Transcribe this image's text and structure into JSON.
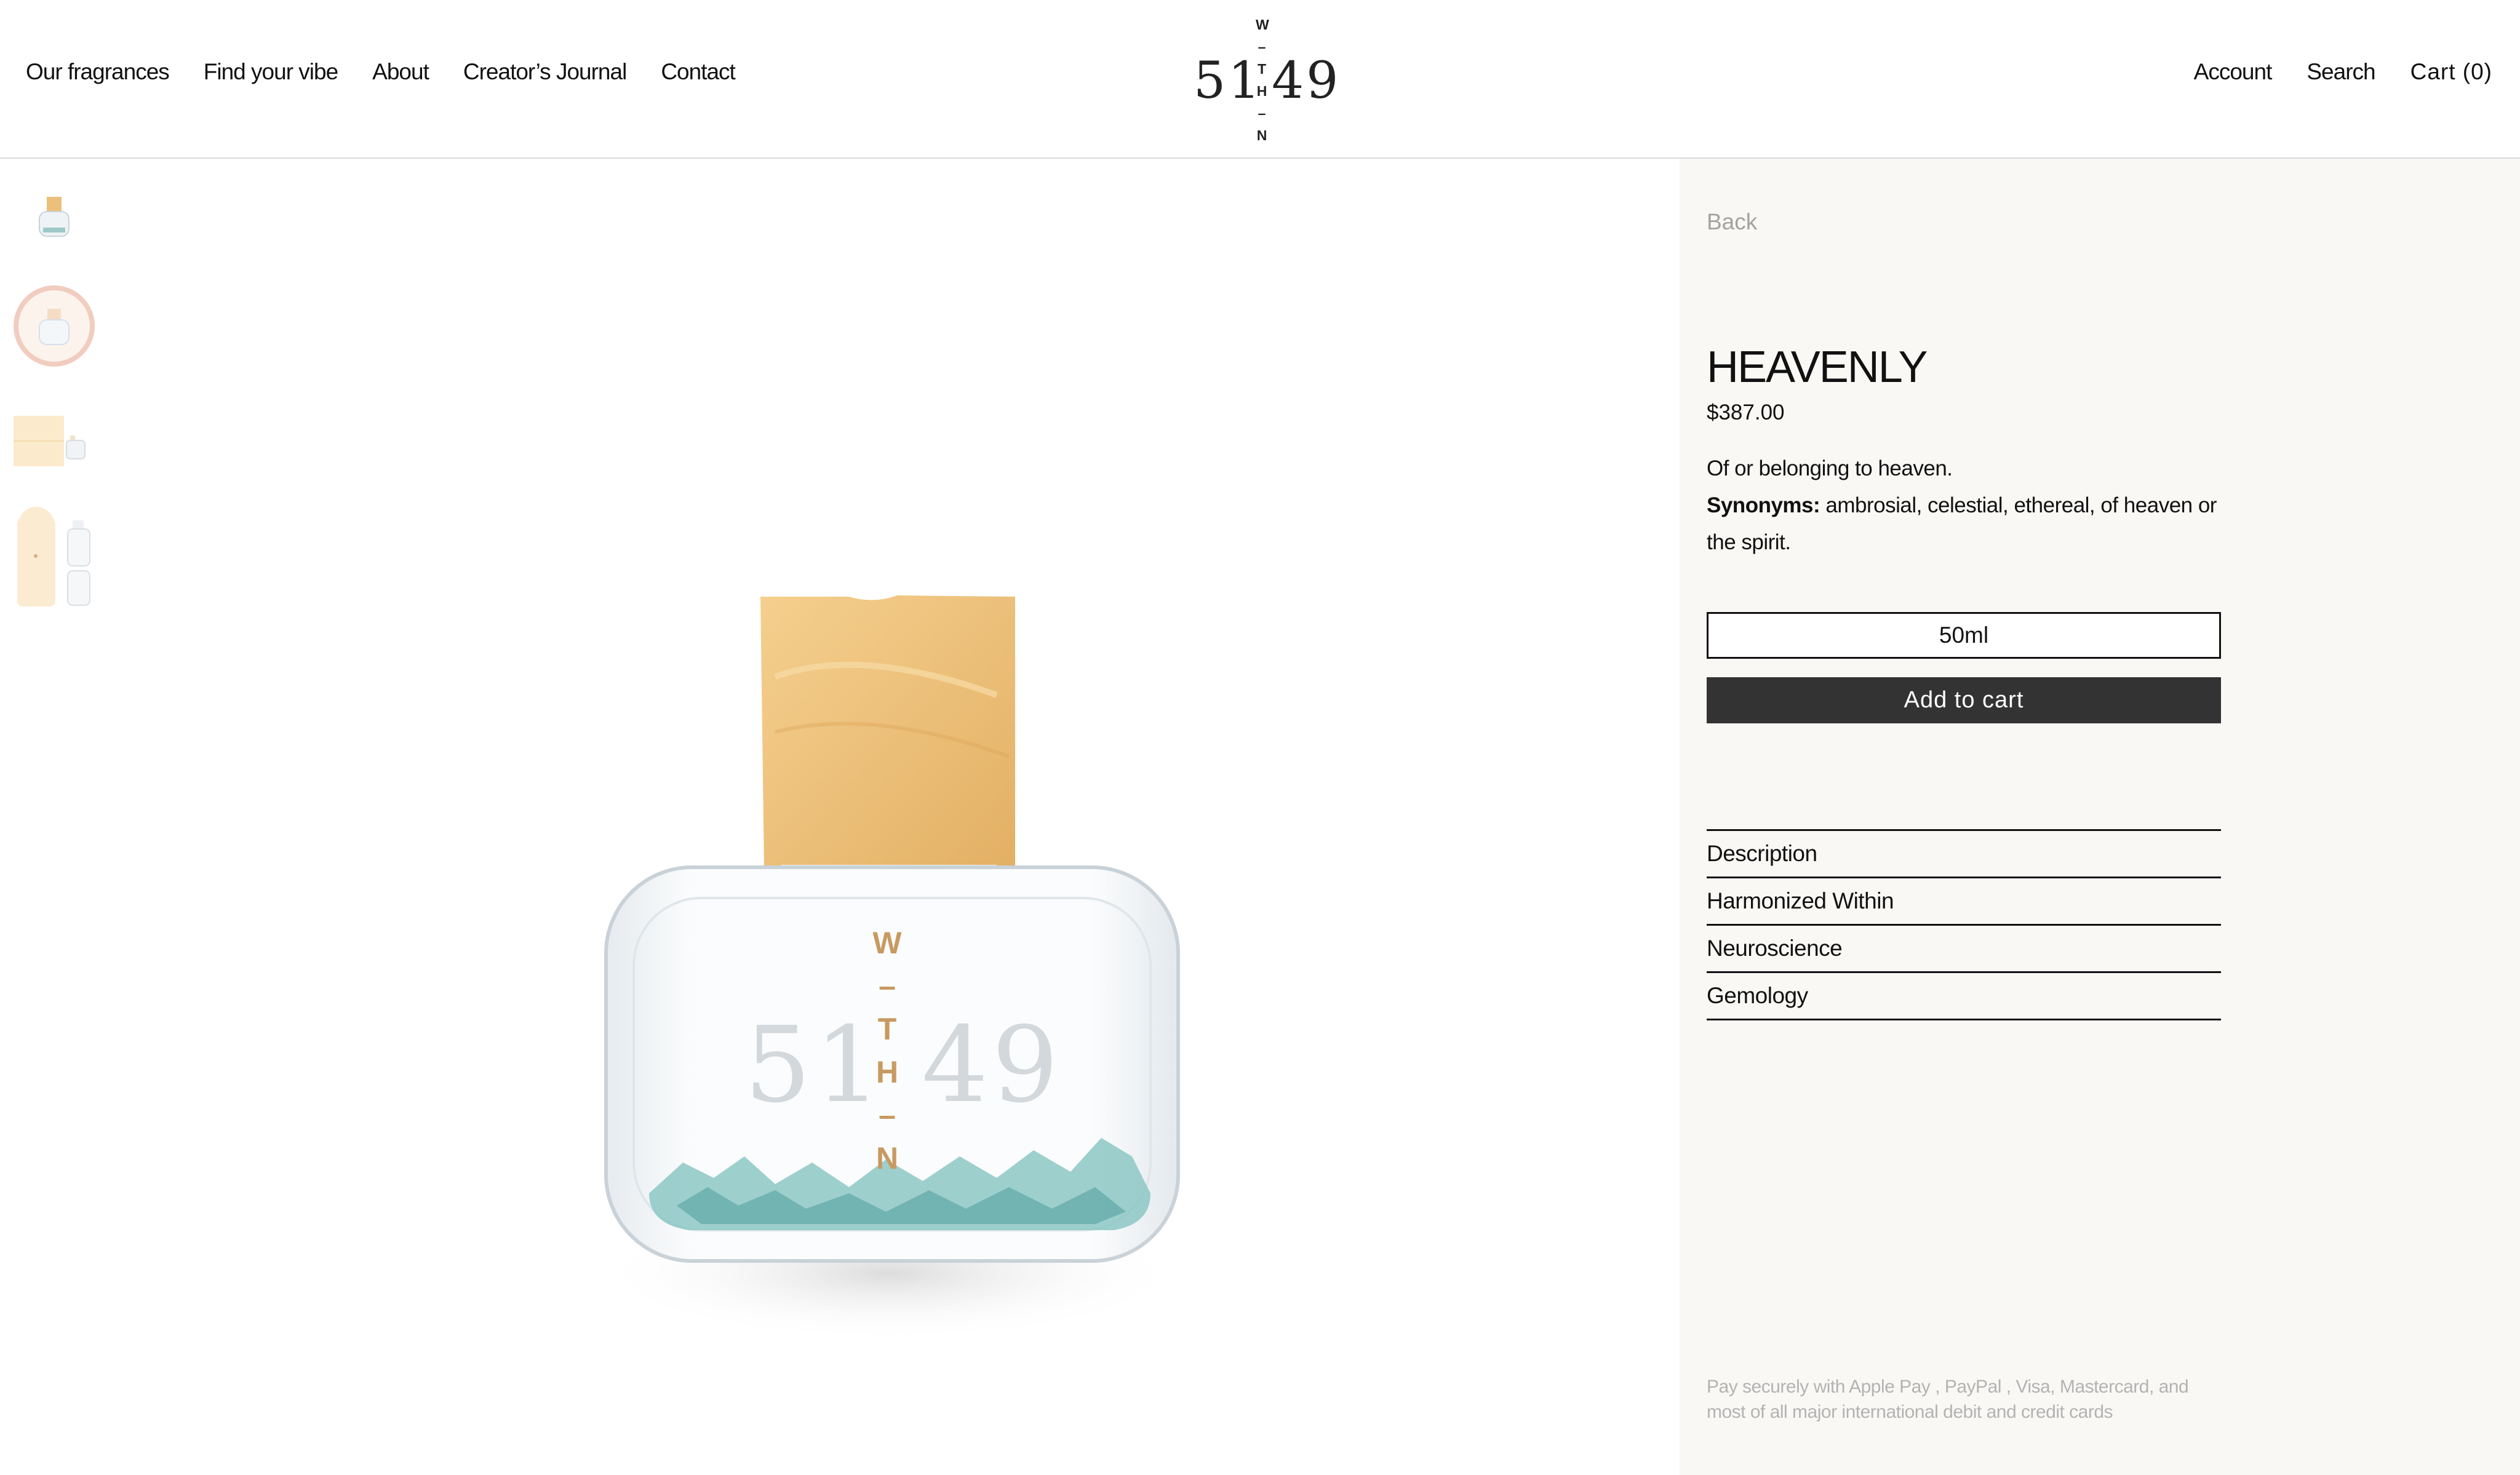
{
  "header": {
    "nav_left": [
      "Our fragrances",
      "Find your vibe",
      "About",
      "Creator’s Journal",
      "Contact"
    ],
    "logo": {
      "left_number": "51",
      "right_number": "49",
      "vertical_letters": [
        "W",
        "–",
        "T",
        "H",
        "–",
        "N"
      ]
    },
    "nav_right": {
      "account": "Account",
      "search": "Search",
      "cart": "Cart (0)"
    }
  },
  "gallery": {
    "thumbnails": [
      "bottle-front",
      "bottle-halo",
      "gift-box",
      "bottle-pouch"
    ],
    "main_image": {
      "logo_left": "51",
      "logo_right": "49",
      "vertical_letters": [
        "W",
        "–",
        "T",
        "H",
        "–",
        "N"
      ]
    }
  },
  "product": {
    "back_label": "Back",
    "title": "HEAVENLY",
    "price": "$387.00",
    "description_line1": "Of or belonging to heaven.",
    "synonyms_label": "Synonyms:",
    "synonyms_text": " ambrosial, celestial, ethereal, of heaven or the spirit.",
    "variant": "50ml",
    "add_to_cart": "Add to cart",
    "accordion": [
      "Description",
      "Harmonized Within",
      "Neuroscience",
      "Gemology"
    ],
    "payment_note": "Pay securely with Apple Pay , PayPal , Visa, Mastercard, and most of all major international debit and credit cards"
  },
  "colors": {
    "panel_bg": "#f9f8f5",
    "button_dark": "#333333",
    "cap_amber": "#ecc07a",
    "crystal_teal": "#7fbfbd",
    "logo_gold": "#c79a62",
    "muted_text": "#a3a3a3"
  }
}
